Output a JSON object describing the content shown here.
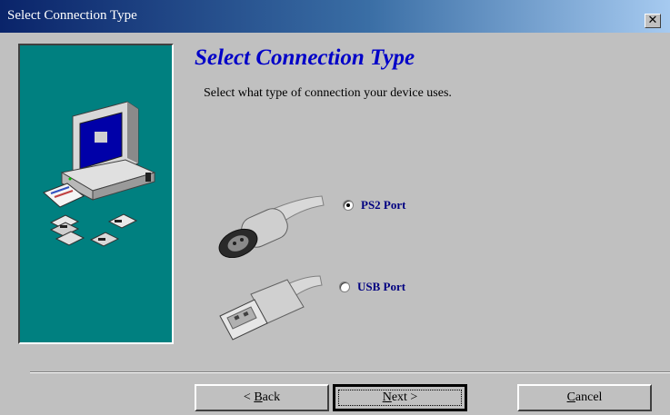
{
  "window": {
    "title": "Select Connection Type",
    "close_glyph": "✕"
  },
  "header": {
    "title": "Select Connection Type",
    "subtitle": "Select what type of connection your device uses."
  },
  "options": [
    {
      "label": "PS2 Port",
      "selected": true
    },
    {
      "label": "USB Port",
      "selected": false
    }
  ],
  "buttons": {
    "back": {
      "prefix": "< ",
      "accel": "B",
      "rest": "ack"
    },
    "next": {
      "accel": "N",
      "rest": "ext >"
    },
    "cancel": {
      "accel": "C",
      "rest": "ancel"
    }
  },
  "icons": {
    "side": "computer-with-disks-illustration",
    "ps2": "ps2-connector-icon",
    "usb": "usb-connector-icon"
  }
}
